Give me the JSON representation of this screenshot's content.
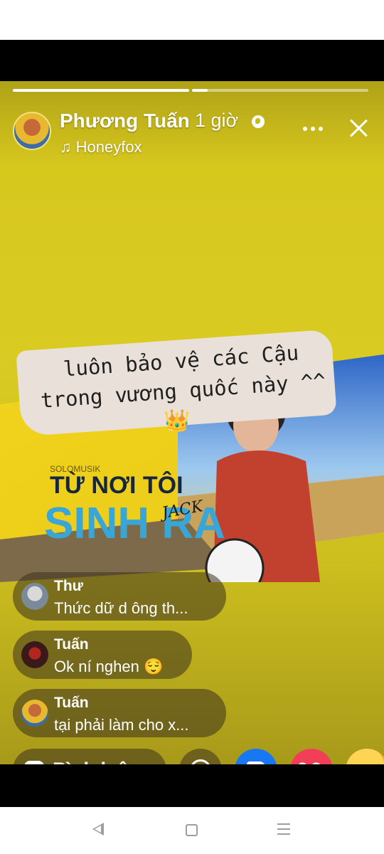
{
  "story": {
    "progress": {
      "segments": 2,
      "current": 2,
      "first_done": true
    },
    "author": "Phương Tuấn",
    "time": "1 giờ",
    "music": "♫ Honeyfox",
    "caption_lines": [
      "luôn bảo vệ các Cậu",
      "trong vương quốc này ^^"
    ],
    "image_title_top": "TỪ NƠI TÔI",
    "image_title_main": "SINH RA",
    "image_title_tag": "JACK",
    "image_small_text": "SOLOMUSIK"
  },
  "comments": [
    {
      "name": "Thư",
      "text": "Thức dữ d ông th..."
    },
    {
      "name": "Tuấn",
      "text": "Ok ní nghen 😌"
    },
    {
      "name": "Tuấn",
      "text": "tại phải làm cho x..."
    }
  ],
  "actions": {
    "comment_label": "Bình luận"
  },
  "colors": {
    "story_bg": "#d6c61c",
    "like": "#1877f2",
    "love": "#f33e58",
    "care": "#f7b125"
  },
  "icons": {
    "globe": "globe-icon",
    "more": "more-icon",
    "close": "close-icon",
    "comment": "comment-icon",
    "messenger": "messenger-icon",
    "like": "like-icon",
    "love": "love-icon",
    "care": "care-icon"
  }
}
